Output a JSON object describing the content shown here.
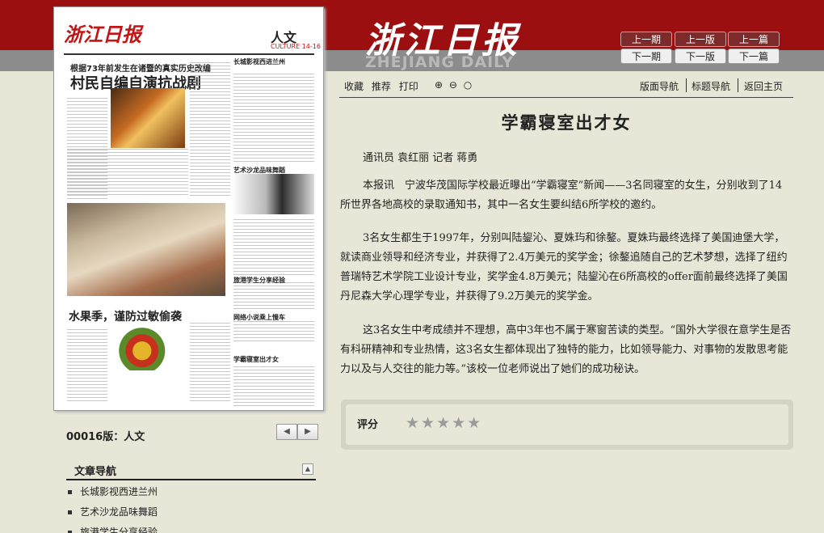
{
  "header": {
    "logo_cn": "浙江日报",
    "logo_en": "ZHEJIANG DAILY",
    "nav": {
      "prev_issue": "上一期",
      "prev_page": "上一版",
      "prev_article": "上一篇",
      "next_issue": "下一期",
      "next_page": "下一版",
      "next_article": "下一篇"
    },
    "colors": {
      "brand_red": "#9b0f10",
      "band_grey": "#8c8c8c"
    }
  },
  "paper": {
    "masthead": "浙江日报",
    "section": "人文",
    "section_en": "CULTURE 14-16",
    "kicker": "根据73年前发生在诸暨的真实历史改编",
    "headline_main": "村民自编自演抗战剧",
    "headline_fruit": "水果季，谨防过敏偷袭",
    "col_heads": {
      "c1": "长城影视西进兰州",
      "c2": "艺术沙龙品味舞蹈",
      "c3": "旅港学生分享经验",
      "c4": "网络小说乘上慢车",
      "c5": "学霸寝室出才女"
    }
  },
  "left": {
    "page_label": "00016版：人文",
    "pager": {
      "prev_icon": "arrow-left-icon",
      "next_icon": "arrow-right-icon"
    },
    "article_nav_title": "文章导航",
    "article_nav_items": [
      "长城影视西进兰州",
      "艺术沙龙品味舞蹈",
      "旅港学生分享经验"
    ]
  },
  "toolbar": {
    "favorite": "收藏",
    "recommend": "推荐",
    "print": "打印",
    "layout_nav": "版面导航",
    "title_nav": "标题导航",
    "home": "返回主页"
  },
  "article": {
    "title": "学霸寝室出才女",
    "byline": "通讯员 袁红丽 记者 蒋勇",
    "paragraphs": [
      "本报讯　宁波华茂国际学校最近曝出“学霸寝室”新闻——3名同寝室的女生，分别收到了14所世界各地高校的录取通知书，其中一名女生要纠结6所学校的邀约。",
      "3名女生都生于1997年，分别叫陆鋆沁、夏姝玙和徐鏊。夏姝玙最终选择了美国迪堡大学，就读商业领导和经济专业，并获得了2.4万美元的奖学金；徐鏊追随自己的艺术梦想，选择了纽约普瑞特艺术学院工业设计专业，奖学金4.8万美元；陆鋆沁在6所高校的offer面前最终选择了美国丹尼森大学心理学专业，并获得了9.2万美元的奖学金。",
      "这3名女生中考成绩并不理想，高中3年也不属于寒窗苦读的类型。“国外大学很在意学生是否有科研精神和专业热情，这3名女生都体现出了独特的能力，比如领导能力、对事物的发散思考能力以及与人交往的能力等。”该校一位老师说出了她们的成功秘诀。"
    ]
  },
  "rating": {
    "label": "评分",
    "stars": "★★★★★",
    "max": 5
  }
}
